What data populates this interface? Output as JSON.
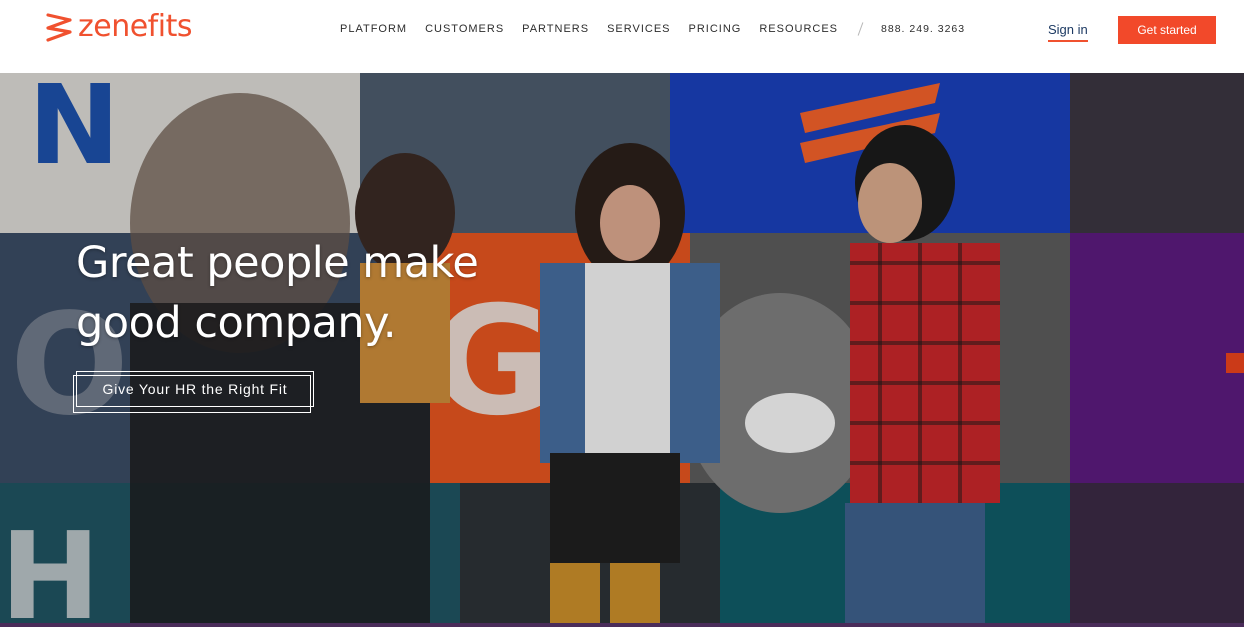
{
  "header": {
    "logo_text": "zenefits",
    "nav": [
      "PLATFORM",
      "CUSTOMERS",
      "PARTNERS",
      "SERVICES",
      "PRICING",
      "RESOURCES"
    ],
    "phone": "888. 249. 3263",
    "sign_in": "Sign in",
    "cta": "Get started"
  },
  "hero": {
    "title_line1": "Great people make",
    "title_line2": "good company.",
    "button_label": "Give Your HR the Right Fit"
  },
  "colors": {
    "brand_orange": "#f0512f",
    "cta_red": "#f2492a",
    "nav_text": "#2d2d2d",
    "signin_blue": "#1d3a63"
  }
}
